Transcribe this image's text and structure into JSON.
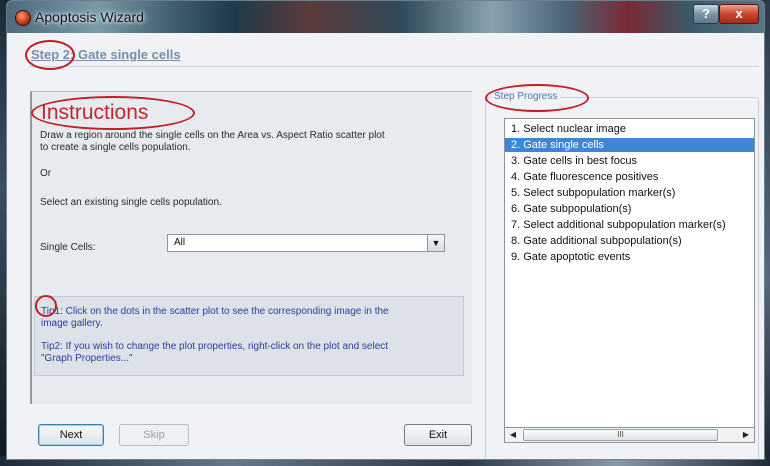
{
  "window": {
    "title": "Apoptosis Wizard",
    "help_label": "?",
    "close_label": "x"
  },
  "step": {
    "title": "Step 2: Gate single cells"
  },
  "instructions": {
    "heading": "Instructions",
    "line1": "Draw a region around the single cells on the Area vs. Aspect Ratio scatter plot",
    "line2": "to create a single cells population.",
    "or": "Or",
    "select_existing": "Select an existing single cells population.",
    "field_label": "Single Cells:",
    "field_value": "All",
    "tip1_line1": "Tip1: Click on the dots in the scatter plot to see the corresponding image in the",
    "tip1_line2": "image gallery.",
    "tip2_line1": "Tip2: If you wish to change the plot properties, right-click on the plot and select",
    "tip2_line2": "\"Graph Properties...\""
  },
  "progress": {
    "label": "Step Progress",
    "selected_index": 1,
    "items": [
      "1. Select nuclear image",
      "2. Gate single cells",
      "3. Gate cells in best focus",
      "4. Gate fluorescence positives",
      "5. Select subpopulation marker(s)",
      "6. Gate subpopulation(s)",
      "7. Select additional subpopulation marker(s)",
      "8. Gate additional subpopulation(s)",
      "9. Gate apoptotic events"
    ],
    "scroll_thumb_glyph": "III"
  },
  "buttons": {
    "next": "Next",
    "skip": "Skip",
    "exit": "Exit"
  },
  "colors": {
    "accent": "#3d86d6",
    "annotation": "#c21f26",
    "tip_text": "#2b3e9c",
    "heading": "#c1272d"
  }
}
